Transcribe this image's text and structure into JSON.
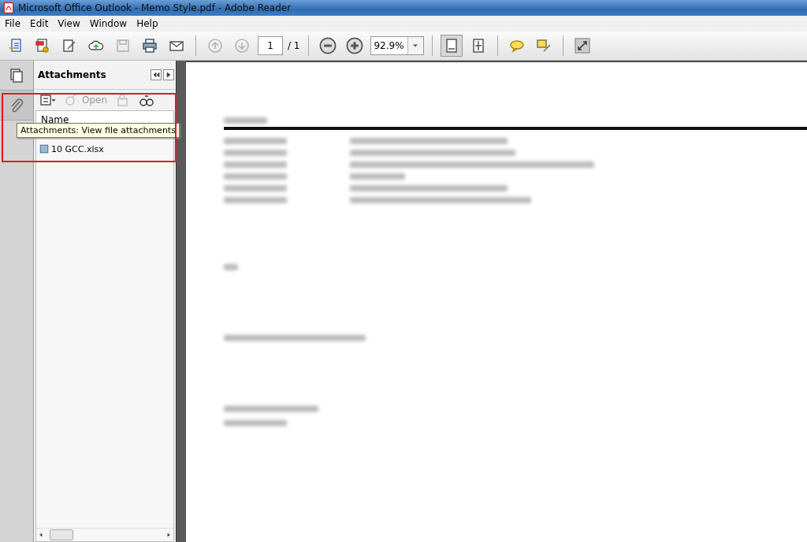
{
  "window": {
    "title": "Microsoft Office Outlook - Memo Style.pdf - Adobe Reader"
  },
  "menu": [
    "File",
    "Edit",
    "View",
    "Window",
    "Help"
  ],
  "toolbar": {
    "buttons": [
      {
        "kind": "create",
        "disabled": false
      },
      {
        "kind": "convert",
        "disabled": false
      },
      {
        "kind": "sign",
        "disabled": false
      },
      {
        "kind": "upload",
        "disabled": false
      },
      {
        "kind": "save",
        "disabled": true
      },
      {
        "kind": "print",
        "disabled": false
      },
      {
        "kind": "mail",
        "disabled": false
      }
    ],
    "nav": [
      {
        "kind": "up",
        "disabled": true
      },
      {
        "kind": "down",
        "disabled": true
      }
    ],
    "page": {
      "value": "1",
      "total": "/ 1"
    },
    "zoom": {
      "value": "92.9%"
    },
    "view_buttons": [
      {
        "kind": "fitpage",
        "selected": true
      },
      {
        "kind": "fitwidth",
        "selected": false
      }
    ],
    "tools": [
      {
        "kind": "comment"
      },
      {
        "kind": "highlight"
      },
      {
        "kind": "expand"
      }
    ]
  },
  "attachments": {
    "title": "Attachments",
    "actions": [
      {
        "kind": "options",
        "disabled": false
      },
      {
        "kind": "open",
        "label": "Open",
        "disabled": true
      },
      {
        "kind": "add",
        "disabled": true
      },
      {
        "kind": "search",
        "disabled": false
      }
    ],
    "column": "Name",
    "files": [
      {
        "name": "10 GCC.xlsx"
      }
    ],
    "tooltip": "Attachments: View file attachments"
  }
}
